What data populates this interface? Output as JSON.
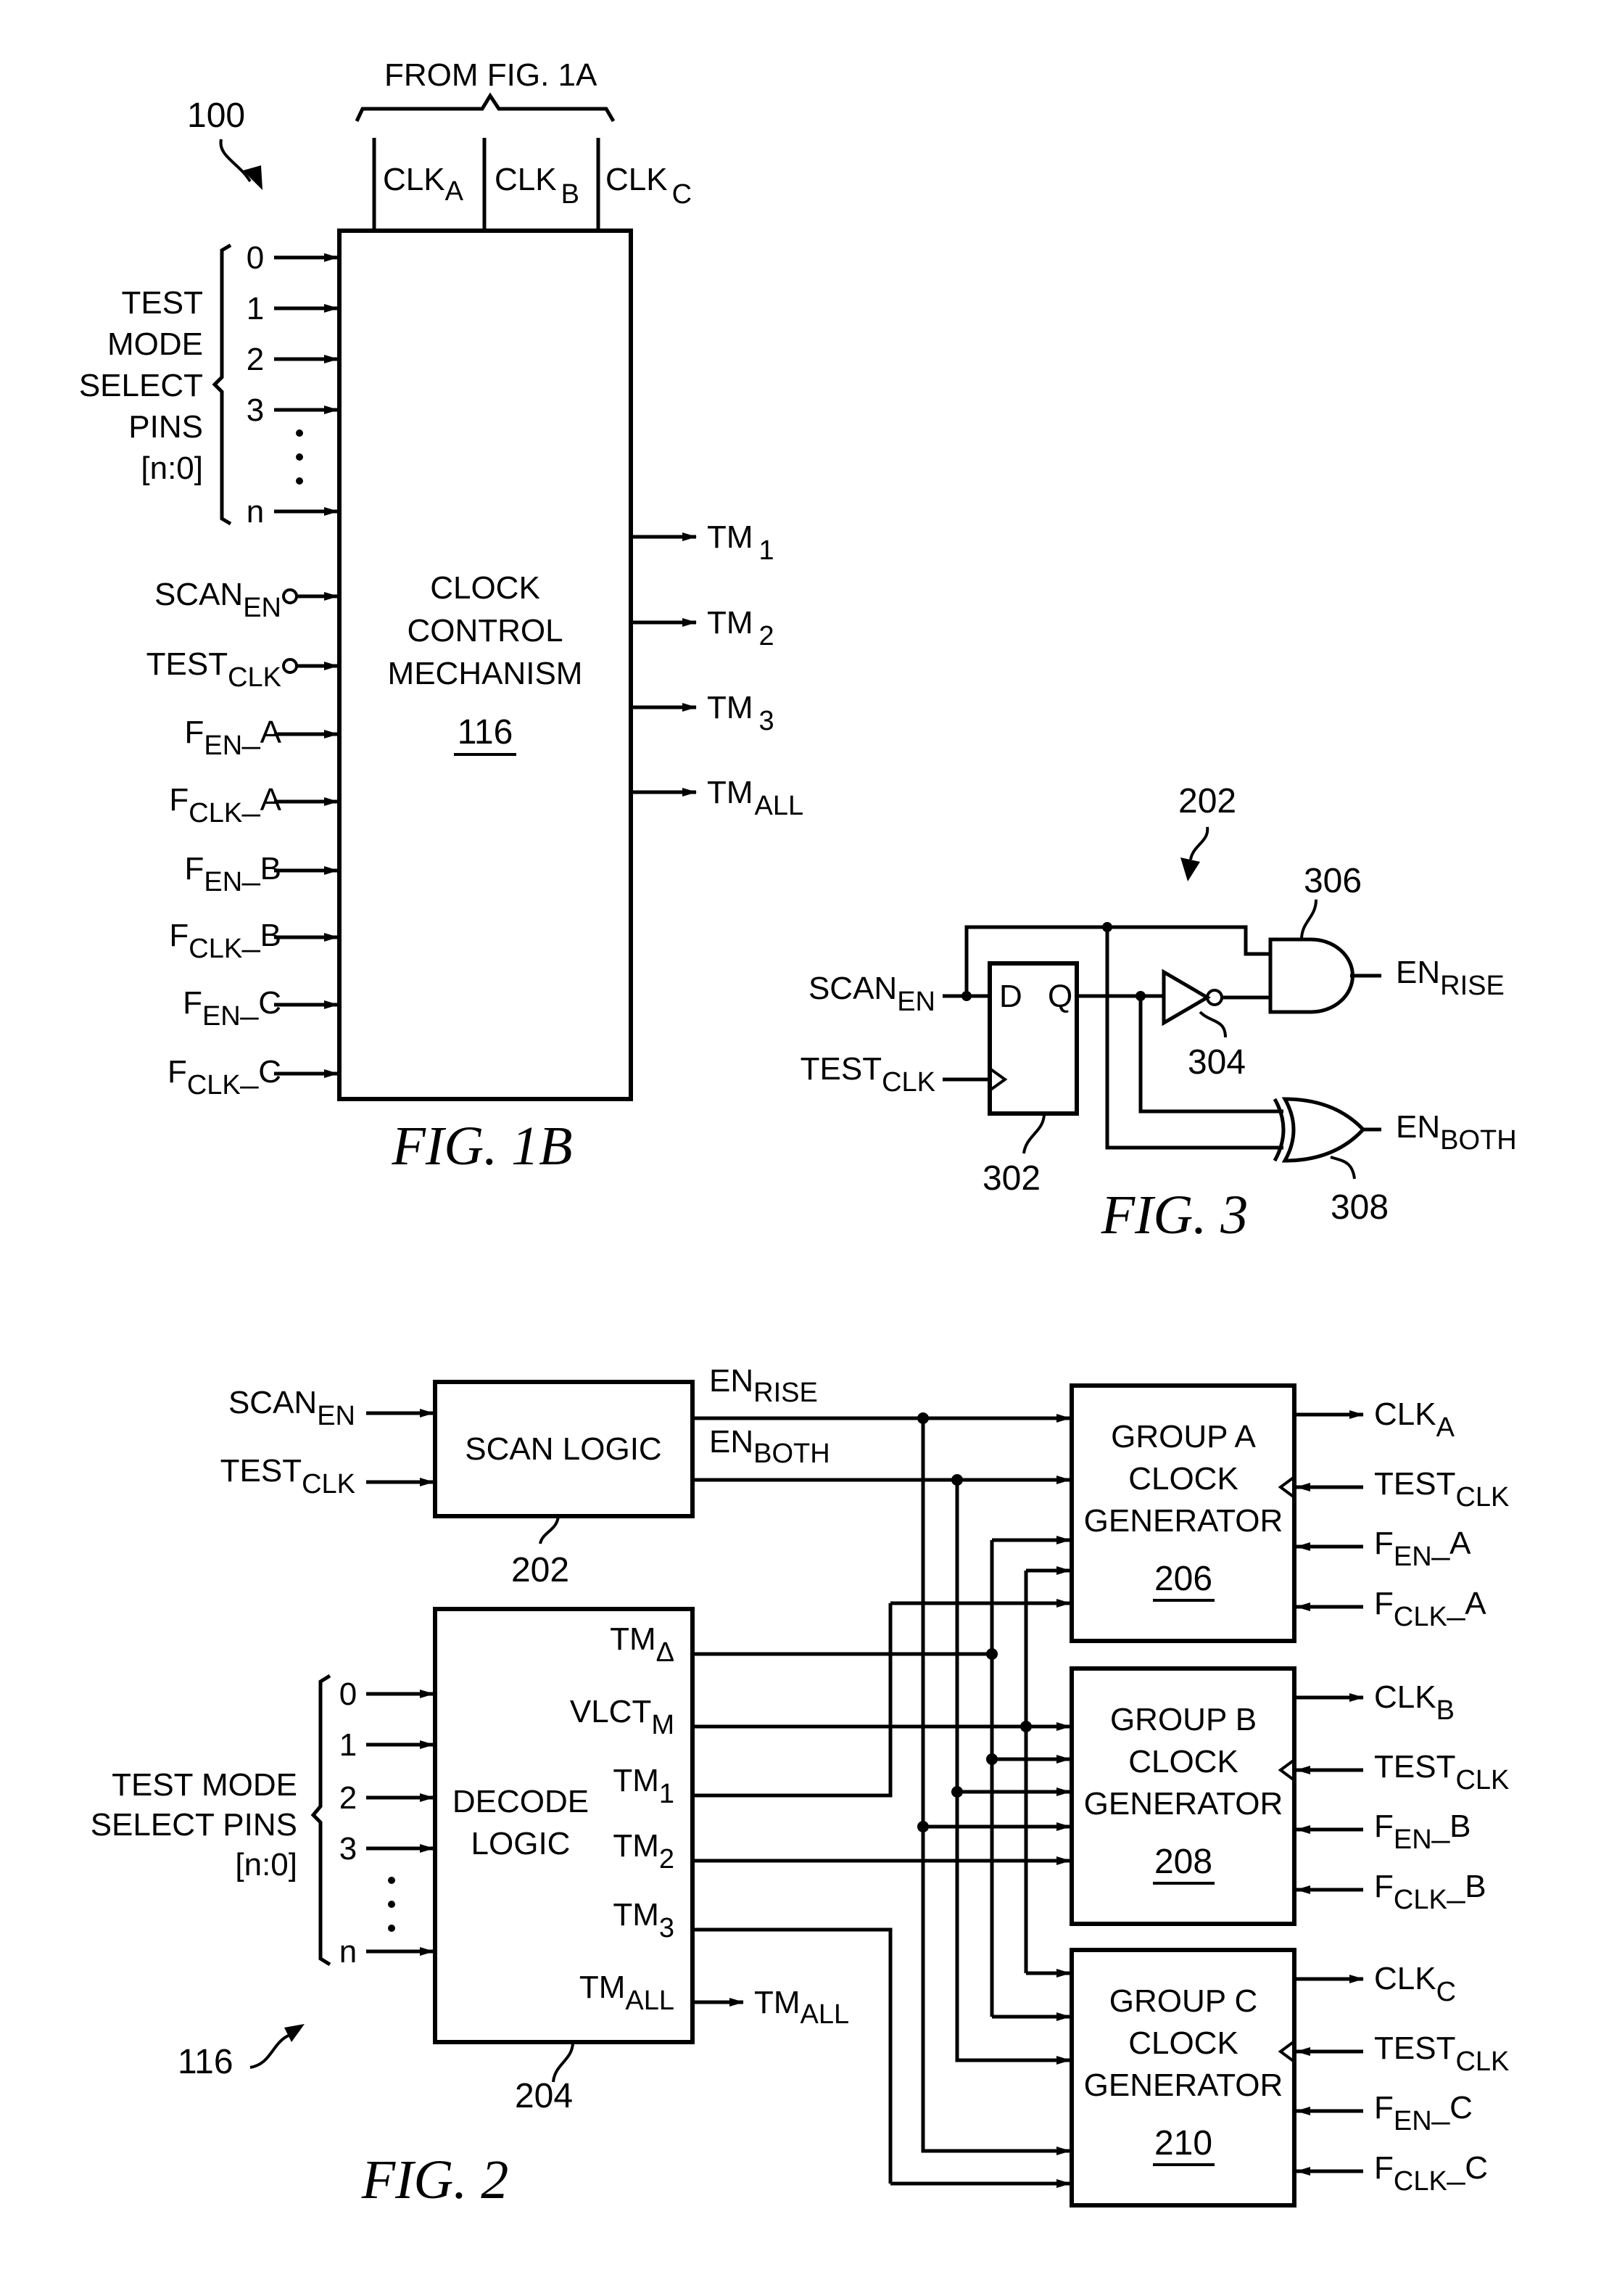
{
  "fig1b": {
    "caption": "FIG. 1B",
    "ref": "100",
    "from_label": "FROM FIG. 1A",
    "top_clocks": [
      {
        "base": "CLK",
        "sub": "A"
      },
      {
        "base": "CLK",
        "sub": "B"
      },
      {
        "base": "CLK",
        "sub": "C"
      }
    ],
    "block": {
      "lines": [
        "CLOCK",
        "CONTROL",
        "MECHANISM"
      ],
      "number": "116"
    },
    "test_mode_label": [
      "TEST",
      "MODE",
      "SELECT",
      "PINS",
      "[n:0]"
    ],
    "pins": [
      "0",
      "1",
      "2",
      "3",
      "n"
    ],
    "ellipsis": "⋮",
    "inputs": [
      {
        "base": "SCAN",
        "sub": "EN",
        "suffix": "",
        "terminal": "circle"
      },
      {
        "base": "TEST",
        "sub": "CLK",
        "suffix": "",
        "terminal": "circle"
      },
      {
        "base": "F",
        "sub": "EN",
        "suffix": "_A",
        "terminal": "arrow"
      },
      {
        "base": "F",
        "sub": "CLK",
        "suffix": "_A",
        "terminal": "arrow"
      },
      {
        "base": "F",
        "sub": "EN",
        "suffix": "_B",
        "terminal": "arrow"
      },
      {
        "base": "F",
        "sub": "CLK",
        "suffix": "_B",
        "terminal": "arrow"
      },
      {
        "base": "F",
        "sub": "EN",
        "suffix": "_C",
        "terminal": "arrow"
      },
      {
        "base": "F",
        "sub": "CLK",
        "suffix": "_C",
        "terminal": "arrow"
      }
    ],
    "outputs": [
      {
        "base": "TM",
        "sub": "1"
      },
      {
        "base": "TM",
        "sub": "2"
      },
      {
        "base": "TM",
        "sub": "3"
      },
      {
        "base": "TM",
        "sub": "ALL"
      }
    ]
  },
  "fig3": {
    "caption": "FIG. 3",
    "ref": "202",
    "inputs": [
      {
        "base": "SCAN",
        "sub": "EN"
      },
      {
        "base": "TEST",
        "sub": "CLK"
      }
    ],
    "flipflop": {
      "ref": "302",
      "d": "D",
      "q": "Q"
    },
    "inverter": {
      "ref": "304"
    },
    "and_gate": {
      "ref": "306"
    },
    "xor_gate": {
      "ref": "308"
    },
    "outputs": [
      {
        "base": "EN",
        "sub": "RISE"
      },
      {
        "base": "EN",
        "sub": "BOTH"
      }
    ]
  },
  "fig2": {
    "caption": "FIG. 2",
    "ref": "116",
    "scan_logic": {
      "label": "SCAN LOGIC",
      "ref": "202"
    },
    "scan_inputs": [
      {
        "base": "SCAN",
        "sub": "EN"
      },
      {
        "base": "TEST",
        "sub": "CLK"
      }
    ],
    "scan_outputs": [
      {
        "base": "EN",
        "sub": "RISE"
      },
      {
        "base": "EN",
        "sub": "BOTH"
      }
    ],
    "decode_logic": {
      "lines": [
        "DECODE",
        "LOGIC"
      ],
      "ref": "204"
    },
    "test_mode_label": [
      "TEST MODE",
      "SELECT PINS",
      "[n:0]"
    ],
    "pins": [
      "0",
      "1",
      "2",
      "3",
      "n"
    ],
    "ellipsis": "⋮",
    "decode_outputs": [
      {
        "base": "TM",
        "sub": "Δ"
      },
      {
        "base": "VLCT",
        "sub": "M"
      },
      {
        "base": "TM",
        "sub": "1"
      },
      {
        "base": "TM",
        "sub": "2"
      },
      {
        "base": "TM",
        "sub": "3"
      },
      {
        "base": "TM",
        "sub": "ALL"
      }
    ],
    "tm_all_out": {
      "base": "TM",
      "sub": "ALL"
    },
    "generators": [
      {
        "lines": [
          "GROUP A",
          "CLOCK",
          "GENERATOR"
        ],
        "number": "206",
        "clk_out": {
          "base": "CLK",
          "sub": "A"
        },
        "inputs": [
          {
            "base": "TEST",
            "sub": "CLK",
            "suffix": ""
          },
          {
            "base": "F",
            "sub": "EN",
            "suffix": "_A"
          },
          {
            "base": "F",
            "sub": "CLK",
            "suffix": "_A"
          }
        ]
      },
      {
        "lines": [
          "GROUP B",
          "CLOCK",
          "GENERATOR"
        ],
        "number": "208",
        "clk_out": {
          "base": "CLK",
          "sub": "B"
        },
        "inputs": [
          {
            "base": "TEST",
            "sub": "CLK",
            "suffix": ""
          },
          {
            "base": "F",
            "sub": "EN",
            "suffix": "_B"
          },
          {
            "base": "F",
            "sub": "CLK",
            "suffix": "_B"
          }
        ]
      },
      {
        "lines": [
          "GROUP C",
          "CLOCK",
          "GENERATOR"
        ],
        "number": "210",
        "clk_out": {
          "base": "CLK",
          "sub": "C"
        },
        "inputs": [
          {
            "base": "TEST",
            "sub": "CLK",
            "suffix": ""
          },
          {
            "base": "F",
            "sub": "EN",
            "suffix": "_C"
          },
          {
            "base": "F",
            "sub": "CLK",
            "suffix": "_C"
          }
        ]
      }
    ]
  }
}
